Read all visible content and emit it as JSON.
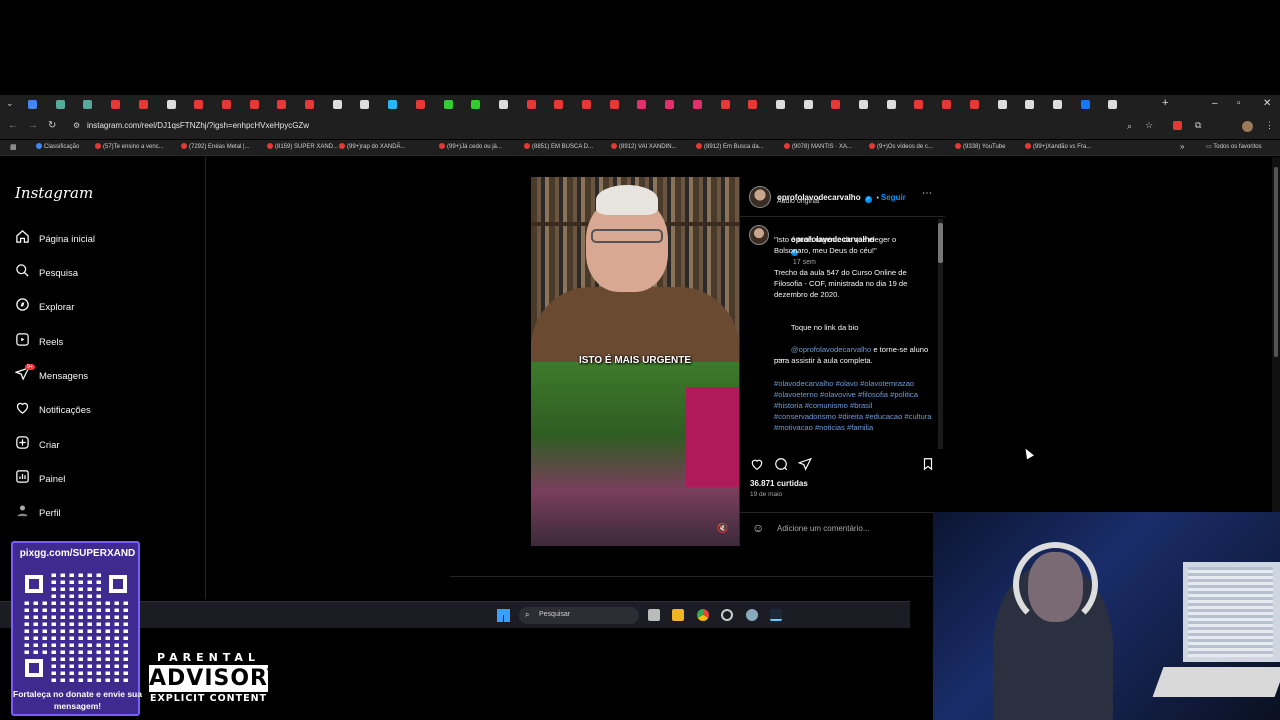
{
  "browser": {
    "url": "instagram.com/reel/DJ1qsFTNZhj/?igsh=enhpcHVxeHpycGZw",
    "bookmarks": [
      "Classificação",
      "(57)Te ensino a venc...",
      "(7292) Enéas Metal |...",
      "(8159) SUPER XAND...",
      "(99+)rap do XANDÃ...",
      "(99+)Já cedo ou já...",
      "(8851) EM BUSCA D...",
      "(8912) VAI XANDIN...",
      "(8912) Em Busca da...",
      "(9078) MANTIS · XA...",
      "(9+)Os vídeos de c...",
      "(9338) YouTube",
      "(99+)Xandão vs Fra..."
    ],
    "all_favorites": "Todos os favoritos"
  },
  "instagram": {
    "logo": "Instagram",
    "nav": [
      {
        "label": "Página inicial",
        "icon": "home-icon"
      },
      {
        "label": "Pesquisa",
        "icon": "search-icon"
      },
      {
        "label": "Explorar",
        "icon": "compass-icon"
      },
      {
        "label": "Reels",
        "icon": "reels-icon"
      },
      {
        "label": "Mensagens",
        "icon": "messages-icon",
        "badge": "9+"
      },
      {
        "label": "Notificações",
        "icon": "heart-icon"
      },
      {
        "label": "Criar",
        "icon": "create-icon"
      },
      {
        "label": "Painel",
        "icon": "dashboard-icon"
      },
      {
        "label": "Perfil",
        "icon": "profile-icon"
      }
    ],
    "reel": {
      "caption_overlay": "ISTO É MAIS URGENTE"
    },
    "post": {
      "username": "oprofolavodecarvalho",
      "follow": "Seguir",
      "audio": "Áudio original",
      "comment_user": "oprofolavodecarvalho",
      "age": "17 sem",
      "text1": "\"Isto é mais urgente do que eleger o Bolsonaro, meu Deus do céu!\"",
      "text2": "Trecho da aula 547 do Curso Online de Filosofia - COF, ministrada no dia 19 de dezembro de 2020.",
      "text3_prefix": "Toque no link da bio",
      "mention": "@oprofolavodecarvalho",
      "text3_suffix": " e torne-se aluno para assistir à aula completa.",
      "divider": "___",
      "hashtags": "#olavodecarvalho #olavo #olavotemrazao #olavoeterno #olavovive #filosofia #politica #historia #comunismo #brasil #conservadorismo #direita #educacao #cultura #motivacao #noticias #familia",
      "likes": "36.871 curtidas",
      "date": "19 de maio",
      "comment_placeholder": "Adicione um comentário..."
    }
  },
  "taskbar": {
    "search": "Pesquisar"
  },
  "overlay": {
    "qr_url": "pixgg.com/SUPERXAND",
    "qr_message": "Fortaleça no donate e envie sua mensagem!",
    "advisory_top": "PARENTAL",
    "advisory_mid": "ADVISORY",
    "advisory_bottom": "EXPLICIT CONTENT"
  },
  "colors": {
    "accent_link": "#0095f6",
    "hashtag": "#6c9bd8",
    "badge": "#ff3040"
  }
}
